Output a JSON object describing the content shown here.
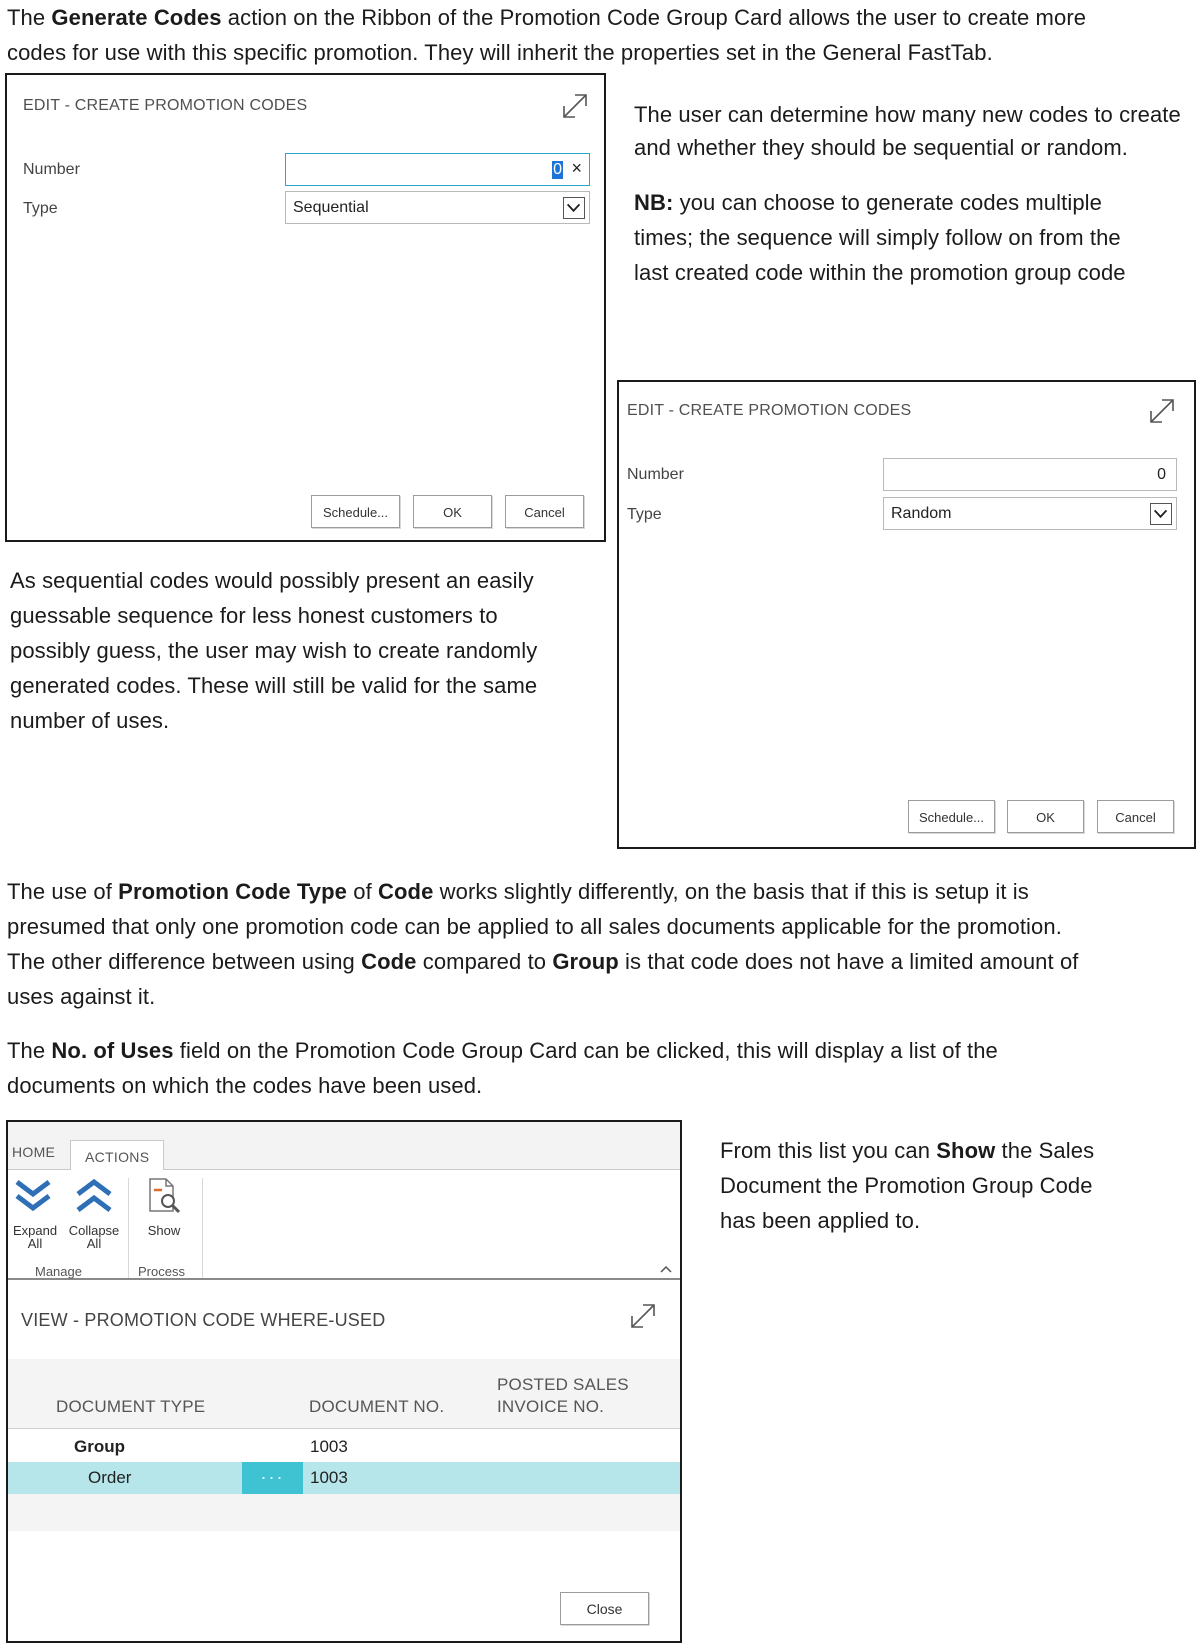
{
  "intro": {
    "l1_a": "The ",
    "l1_b": "Generate Codes",
    "l1_c": " action on the Ribbon of the Promotion Code Group Card allows the user to create more",
    "l2": "codes for use with this specific promotion. They will inherit the properties set in the General FastTab."
  },
  "dialog1": {
    "title": "EDIT - CREATE PROMOTION CODES",
    "number_label": "Number",
    "number_value": "0",
    "clear_glyph": "×",
    "type_label": "Type",
    "type_value": "Sequential",
    "schedule_label": "Schedule...",
    "ok_label": "OK",
    "cancel_label": "Cancel"
  },
  "side_text": {
    "l1": "The user can determine how many new codes to create",
    "l2": "and whether they should be sequential or random.",
    "nb_bold": "NB:",
    "nb_l1": " you can choose to generate codes multiple",
    "nb_l2": "times; the sequence will simply follow on from the",
    "nb_l3": "last created code within the promotion group code"
  },
  "left_text": {
    "l1": "As sequential codes would possibly present an easily",
    "l2": "guessable sequence for less honest customers to",
    "l3": "possibly guess, the user may wish to create randomly",
    "l4": "generated codes. These will still be valid for the same",
    "l5": "number of uses."
  },
  "dialog2": {
    "title": "EDIT - CREATE PROMOTION CODES",
    "number_label": "Number",
    "number_value": "0",
    "type_label": "Type",
    "type_value": "Random",
    "schedule_label": "Schedule...",
    "ok_label": "OK",
    "cancel_label": "Cancel"
  },
  "code_text": {
    "l1_a": "The use of ",
    "l1_b": "Promotion Code Type",
    "l1_c": " of ",
    "l1_d": "Code",
    "l1_e": " works slightly differently, on the basis that if this is setup it is",
    "l2": "presumed that only one promotion code can be applied to all sales documents applicable for the promotion.",
    "l3_a": "The other difference between using ",
    "l3_b": "Code",
    "l3_c": " compared to ",
    "l3_d": "Group",
    "l3_e": " is that code does not have a limited amount of",
    "l4": "uses against it."
  },
  "uses_text": {
    "l1_a": "The ",
    "l1_b": "No. of Uses",
    "l1_c": " field on the Promotion Code Group Card can be clicked, this will display a list of the",
    "l2": "documents on which the codes have been used."
  },
  "where_used": {
    "tabs": [
      "HOME",
      "ACTIONS"
    ],
    "expand_all": [
      "Expand",
      "All"
    ],
    "collapse_all": [
      "Collapse",
      "All"
    ],
    "show": "Show",
    "group_manage": "Manage",
    "group_process": "Process",
    "title": "VIEW - PROMOTION CODE WHERE-USED",
    "columns": {
      "doc_type": "DOCUMENT TYPE",
      "doc_no": "DOCUMENT NO.",
      "posted_1": "POSTED SALES",
      "posted_2": "INVOICE NO."
    },
    "rows": [
      {
        "type": "Group",
        "no": "1003"
      },
      {
        "type": "Order",
        "no": "1003"
      }
    ],
    "row_menu": "···",
    "close_label": "Close"
  },
  "show_text": {
    "l1_a": "From this list you can ",
    "l1_b": "Show",
    "l1_c": " the Sales",
    "l2": "Document the Promotion Group Code",
    "l3": "has been applied to."
  }
}
